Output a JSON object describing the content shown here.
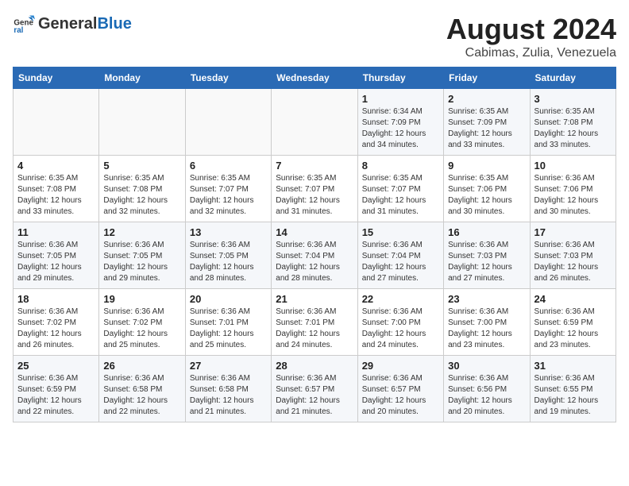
{
  "header": {
    "logo_general": "General",
    "logo_blue": "Blue",
    "title": "August 2024",
    "subtitle": "Cabimas, Zulia, Venezuela"
  },
  "weekdays": [
    "Sunday",
    "Monday",
    "Tuesday",
    "Wednesday",
    "Thursday",
    "Friday",
    "Saturday"
  ],
  "weeks": [
    [
      {
        "day": "",
        "info": ""
      },
      {
        "day": "",
        "info": ""
      },
      {
        "day": "",
        "info": ""
      },
      {
        "day": "",
        "info": ""
      },
      {
        "day": "1",
        "info": "Sunrise: 6:34 AM\nSunset: 7:09 PM\nDaylight: 12 hours\nand 34 minutes."
      },
      {
        "day": "2",
        "info": "Sunrise: 6:35 AM\nSunset: 7:09 PM\nDaylight: 12 hours\nand 33 minutes."
      },
      {
        "day": "3",
        "info": "Sunrise: 6:35 AM\nSunset: 7:08 PM\nDaylight: 12 hours\nand 33 minutes."
      }
    ],
    [
      {
        "day": "4",
        "info": "Sunrise: 6:35 AM\nSunset: 7:08 PM\nDaylight: 12 hours\nand 33 minutes."
      },
      {
        "day": "5",
        "info": "Sunrise: 6:35 AM\nSunset: 7:08 PM\nDaylight: 12 hours\nand 32 minutes."
      },
      {
        "day": "6",
        "info": "Sunrise: 6:35 AM\nSunset: 7:07 PM\nDaylight: 12 hours\nand 32 minutes."
      },
      {
        "day": "7",
        "info": "Sunrise: 6:35 AM\nSunset: 7:07 PM\nDaylight: 12 hours\nand 31 minutes."
      },
      {
        "day": "8",
        "info": "Sunrise: 6:35 AM\nSunset: 7:07 PM\nDaylight: 12 hours\nand 31 minutes."
      },
      {
        "day": "9",
        "info": "Sunrise: 6:35 AM\nSunset: 7:06 PM\nDaylight: 12 hours\nand 30 minutes."
      },
      {
        "day": "10",
        "info": "Sunrise: 6:36 AM\nSunset: 7:06 PM\nDaylight: 12 hours\nand 30 minutes."
      }
    ],
    [
      {
        "day": "11",
        "info": "Sunrise: 6:36 AM\nSunset: 7:05 PM\nDaylight: 12 hours\nand 29 minutes."
      },
      {
        "day": "12",
        "info": "Sunrise: 6:36 AM\nSunset: 7:05 PM\nDaylight: 12 hours\nand 29 minutes."
      },
      {
        "day": "13",
        "info": "Sunrise: 6:36 AM\nSunset: 7:05 PM\nDaylight: 12 hours\nand 28 minutes."
      },
      {
        "day": "14",
        "info": "Sunrise: 6:36 AM\nSunset: 7:04 PM\nDaylight: 12 hours\nand 28 minutes."
      },
      {
        "day": "15",
        "info": "Sunrise: 6:36 AM\nSunset: 7:04 PM\nDaylight: 12 hours\nand 27 minutes."
      },
      {
        "day": "16",
        "info": "Sunrise: 6:36 AM\nSunset: 7:03 PM\nDaylight: 12 hours\nand 27 minutes."
      },
      {
        "day": "17",
        "info": "Sunrise: 6:36 AM\nSunset: 7:03 PM\nDaylight: 12 hours\nand 26 minutes."
      }
    ],
    [
      {
        "day": "18",
        "info": "Sunrise: 6:36 AM\nSunset: 7:02 PM\nDaylight: 12 hours\nand 26 minutes."
      },
      {
        "day": "19",
        "info": "Sunrise: 6:36 AM\nSunset: 7:02 PM\nDaylight: 12 hours\nand 25 minutes."
      },
      {
        "day": "20",
        "info": "Sunrise: 6:36 AM\nSunset: 7:01 PM\nDaylight: 12 hours\nand 25 minutes."
      },
      {
        "day": "21",
        "info": "Sunrise: 6:36 AM\nSunset: 7:01 PM\nDaylight: 12 hours\nand 24 minutes."
      },
      {
        "day": "22",
        "info": "Sunrise: 6:36 AM\nSunset: 7:00 PM\nDaylight: 12 hours\nand 24 minutes."
      },
      {
        "day": "23",
        "info": "Sunrise: 6:36 AM\nSunset: 7:00 PM\nDaylight: 12 hours\nand 23 minutes."
      },
      {
        "day": "24",
        "info": "Sunrise: 6:36 AM\nSunset: 6:59 PM\nDaylight: 12 hours\nand 23 minutes."
      }
    ],
    [
      {
        "day": "25",
        "info": "Sunrise: 6:36 AM\nSunset: 6:59 PM\nDaylight: 12 hours\nand 22 minutes."
      },
      {
        "day": "26",
        "info": "Sunrise: 6:36 AM\nSunset: 6:58 PM\nDaylight: 12 hours\nand 22 minutes."
      },
      {
        "day": "27",
        "info": "Sunrise: 6:36 AM\nSunset: 6:58 PM\nDaylight: 12 hours\nand 21 minutes."
      },
      {
        "day": "28",
        "info": "Sunrise: 6:36 AM\nSunset: 6:57 PM\nDaylight: 12 hours\nand 21 minutes."
      },
      {
        "day": "29",
        "info": "Sunrise: 6:36 AM\nSunset: 6:57 PM\nDaylight: 12 hours\nand 20 minutes."
      },
      {
        "day": "30",
        "info": "Sunrise: 6:36 AM\nSunset: 6:56 PM\nDaylight: 12 hours\nand 20 minutes."
      },
      {
        "day": "31",
        "info": "Sunrise: 6:36 AM\nSunset: 6:55 PM\nDaylight: 12 hours\nand 19 minutes."
      }
    ]
  ]
}
